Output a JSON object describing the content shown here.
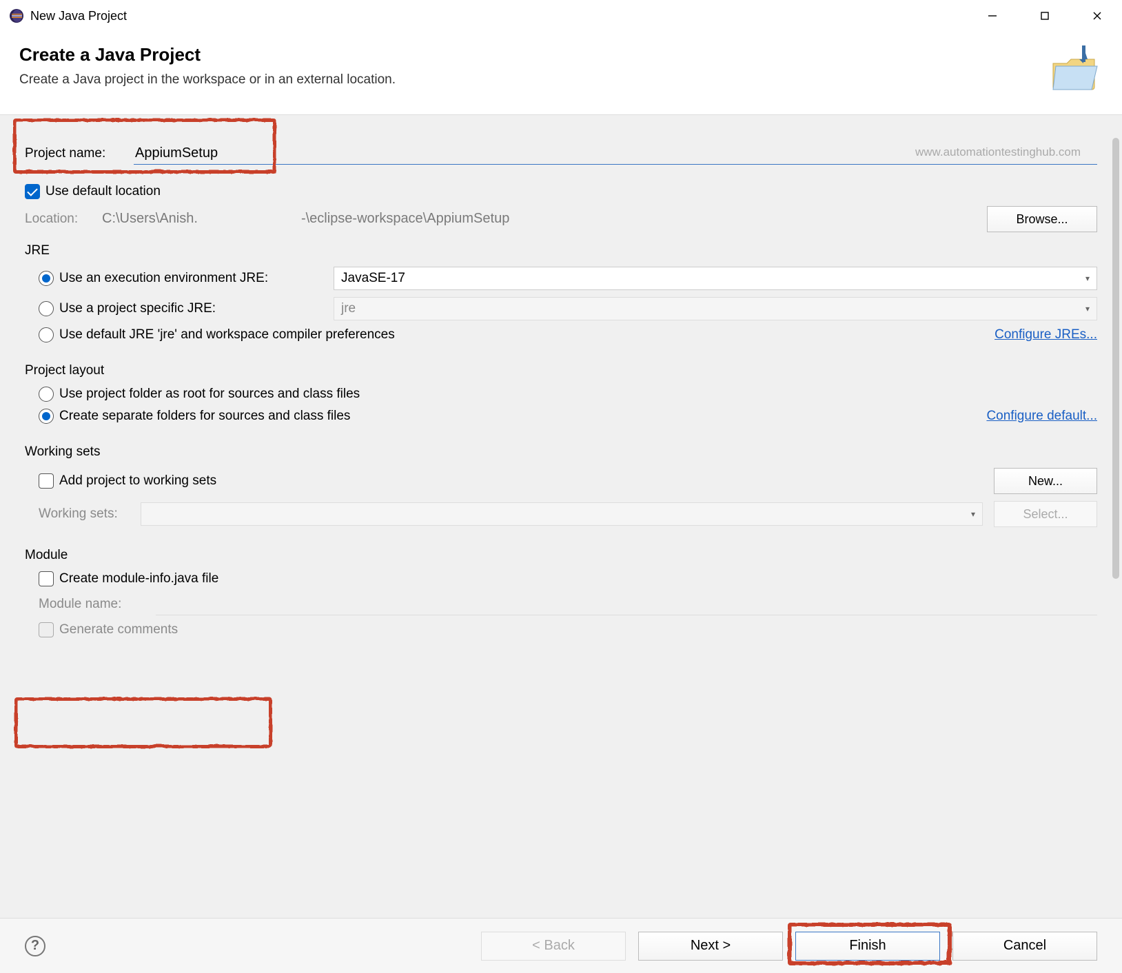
{
  "window": {
    "title": "New Java Project"
  },
  "header": {
    "title": "Create a Java Project",
    "subtitle": "Create a Java project in the workspace or in an external location."
  },
  "watermark": "www.automationtestinghub.com",
  "project": {
    "nameLabel": "Project name:",
    "nameValue": "AppiumSetup",
    "useDefaultLocation": "Use default location",
    "locationLabel": "Location:",
    "locationValue": "C:\\Users\\Anish.                           -\\eclipse-workspace\\AppiumSetup",
    "browse": "Browse..."
  },
  "jre": {
    "groupLabel": "JRE",
    "opt1": "Use an execution environment JRE:",
    "opt1Value": "JavaSE-17",
    "opt2": "Use a project specific JRE:",
    "opt2Value": "jre",
    "opt3": "Use default JRE 'jre' and workspace compiler preferences",
    "configure": "Configure JREs..."
  },
  "layout": {
    "groupLabel": "Project layout",
    "opt1": "Use project folder as root for sources and class files",
    "opt2": "Create separate folders for sources and class files",
    "configure": "Configure default..."
  },
  "working": {
    "groupLabel": "Working sets",
    "add": "Add project to working sets",
    "new": "New...",
    "label": "Working sets:",
    "select": "Select..."
  },
  "module": {
    "groupLabel": "Module",
    "create": "Create module-info.java file",
    "nameLabel": "Module name:",
    "generate": "Generate comments"
  },
  "footer": {
    "back": "< Back",
    "next": "Next >",
    "finish": "Finish",
    "cancel": "Cancel"
  }
}
